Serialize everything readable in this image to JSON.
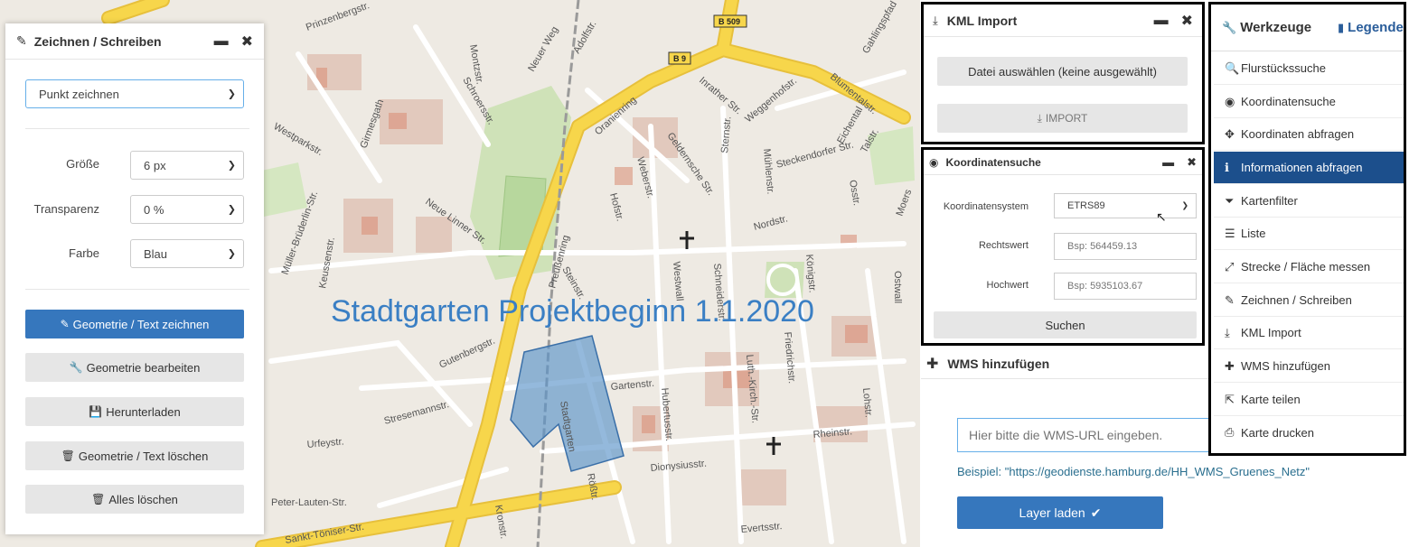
{
  "map": {
    "overlay_title": "Stadtgarten Projektbeginn 1.1.2020",
    "road_shields": [
      "B 509",
      "B 9"
    ],
    "street_labels": [
      "Prinzenbergstr.",
      "Montzstr.",
      "Adolfstr.",
      "Neuer Weg",
      "Schroersstr.",
      "Girmesgath",
      "Westparkstr.",
      "Oranienring",
      "Inrather Str.",
      "Weggenhofstr.",
      "Blumentalstr.",
      "Gahlingspfad",
      "Steckendorfer Str.",
      "Eichental",
      "Talstr.",
      "Geldernsche Str.",
      "Weberstr.",
      "Hofstr.",
      "Sternstr.",
      "Mühlenstr.",
      "Nordstr.",
      "Ostwall",
      "Westwall",
      "Preußenring",
      "Steinstr.",
      "Schneiderstr.",
      "Königstr.",
      "Gartenstr.",
      "Hubertusstr.",
      "Luth.-Kirch.-Str.",
      "Friedrichstr.",
      "Rheinstr.",
      "Lohstr.",
      "Dionysiusstr.",
      "Stadtgarten",
      "Rößtr.",
      "Gutenbergstr.",
      "Stresemannstr.",
      "Urfeystr.",
      "Peter-Lauten-Str.",
      "Sankt-Töniser-Str.",
      "Kronstr.",
      "Evertsstr.",
      "Neue Linner Str.",
      "Müller-Brüderlin-Str.",
      "Keussenstr.",
      "Osstr.",
      "Moers"
    ]
  },
  "draw_panel": {
    "title": "Zeichnen / Schreiben",
    "mode_select": "Punkt zeichnen",
    "size_label": "Größe",
    "size_value": "6 px",
    "transparency_label": "Transparenz",
    "transparency_value": "0 %",
    "color_label": "Farbe",
    "color_value": "Blau",
    "btn_draw": "Geometrie / Text zeichnen",
    "btn_edit": "Geometrie bearbeiten",
    "btn_download": "Herunterladen",
    "btn_delete": "Geometrie / Text löschen",
    "btn_delete_all": "Alles löschen"
  },
  "kml_panel": {
    "title": "KML Import",
    "file_button": "Datei auswählen (keine ausgewählt)",
    "import_button": "IMPORT"
  },
  "koord_panel": {
    "title": "Koordinatensuche",
    "system_label": "Koordinatensystem",
    "system_value": "ETRS89",
    "rechts_label": "Rechtswert",
    "rechts_placeholder": "Bsp: 564459.13",
    "hoch_label": "Hochwert",
    "hoch_placeholder": "Bsp: 5935103.67",
    "search_button": "Suchen"
  },
  "wms_panel": {
    "title": "WMS hinzufügen",
    "url_placeholder": "Hier bitte die WMS-URL eingeben.",
    "example_text": "Beispiel: \"https://geodienste.hamburg.de/HH_WMS_Gruenes_Netz\"",
    "load_button": "Layer laden"
  },
  "tools_menu": {
    "tab_tools": "Werkzeuge",
    "tab_legend": "Legende",
    "items": [
      {
        "label": "Flurstückssuche",
        "icon": "search-icon"
      },
      {
        "label": "Koordinatensuche",
        "icon": "target-icon"
      },
      {
        "label": "Koordinaten abfragen",
        "icon": "move-arrows-icon"
      },
      {
        "label": "Informationen abfragen",
        "icon": "info-icon",
        "active": true
      },
      {
        "label": "Kartenfilter",
        "icon": "filter-icon"
      },
      {
        "label": "Liste",
        "icon": "list-icon"
      },
      {
        "label": "Strecke / Fläche messen",
        "icon": "resize-icon"
      },
      {
        "label": "Zeichnen / Schreiben",
        "icon": "pencil-icon"
      },
      {
        "label": "KML Import",
        "icon": "import-icon"
      },
      {
        "label": "WMS hinzufügen",
        "icon": "plus-icon"
      },
      {
        "label": "Karte teilen",
        "icon": "share-icon"
      },
      {
        "label": "Karte drucken",
        "icon": "print-icon"
      }
    ]
  },
  "colors": {
    "primary_blue": "#3677bd",
    "menu_active": "#1c4f8c",
    "road_yellow": "#f7d64b",
    "polygon_fill": "#5b93c9",
    "map_bg": "#eeeae3"
  }
}
